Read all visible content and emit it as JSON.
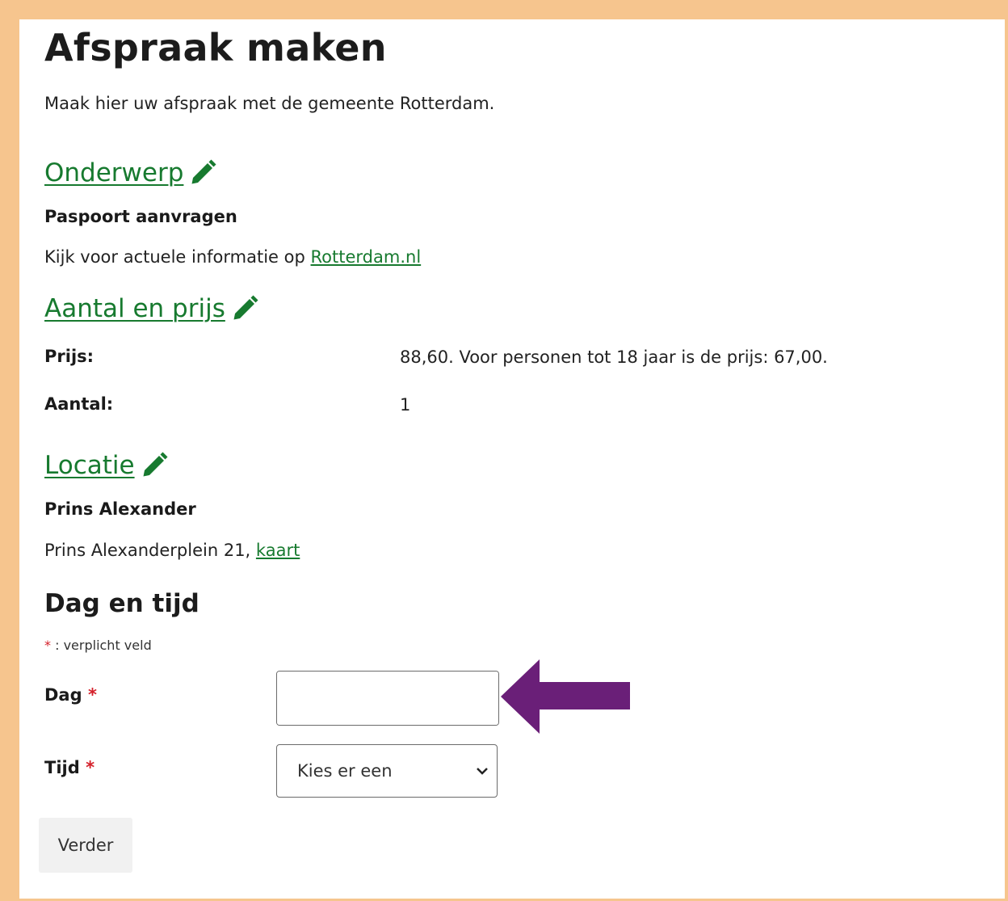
{
  "page": {
    "title": "Afspraak maken",
    "intro": "Maak hier uw afspraak met de gemeente Rotterdam."
  },
  "onderwerp": {
    "heading": "Onderwerp",
    "subject": "Paspoort aanvragen",
    "info_prefix": "Kijk voor actuele informatie op",
    "info_link": "Rotterdam.nl"
  },
  "aantal_prijs": {
    "heading": "Aantal en prijs",
    "price_label": "Prijs:",
    "price_value": "88,60. Voor personen tot 18 jaar is de prijs: 67,00.",
    "amount_label": "Aantal:",
    "amount_value": "1"
  },
  "locatie": {
    "heading": "Locatie",
    "name": "Prins Alexander",
    "address": "Prins Alexanderplein 21,",
    "map_link": "kaart"
  },
  "dag_tijd": {
    "heading": "Dag en tijd",
    "required_star": "*",
    "required_note": ": verplicht veld",
    "day_label": "Dag",
    "day_value": "",
    "time_label": "Tijd",
    "time_selected": "Kies er een",
    "submit_label": "Verder"
  },
  "icons": {
    "edit": "pencil-icon",
    "calendar": "calendar-icon",
    "select": "chevron-down-icon",
    "annotation": "arrow-left-icon"
  },
  "colors": {
    "link_green": "#177a2f",
    "required_red": "#d4202a",
    "arrow_purple": "#6a1f78",
    "frame_orange": "#f6c58e"
  }
}
